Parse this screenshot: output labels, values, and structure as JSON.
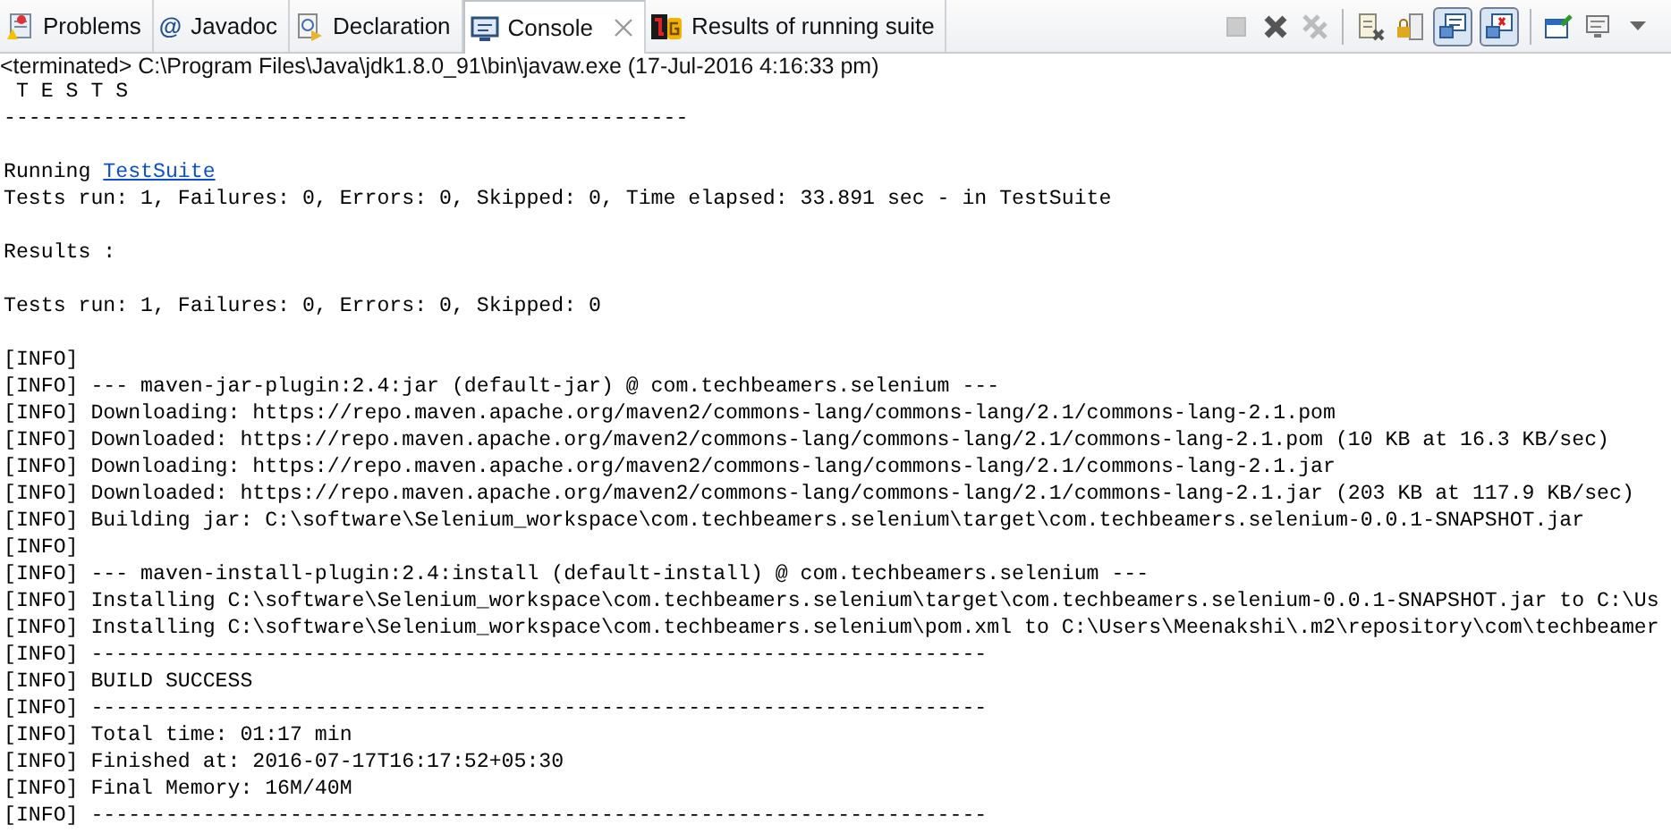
{
  "tabs": [
    {
      "label": "Problems",
      "kind": "problems",
      "selected": false,
      "closable": false
    },
    {
      "label": "Javadoc",
      "kind": "javadoc",
      "glyph": "@",
      "selected": false,
      "closable": false
    },
    {
      "label": "Declaration",
      "kind": "declaration",
      "selected": false,
      "closable": false
    },
    {
      "label": "Console",
      "kind": "console",
      "selected": true,
      "closable": true
    },
    {
      "label": "Results of running suite",
      "kind": "results",
      "selected": false,
      "closable": false
    }
  ],
  "toolbar": [
    {
      "kind": "stop",
      "disabled": true
    },
    {
      "kind": "remove",
      "disabled": false
    },
    {
      "kind": "remove-all",
      "disabled": true
    },
    {
      "kind": "sep"
    },
    {
      "kind": "clear",
      "disabled": false
    },
    {
      "kind": "scroll-lock",
      "disabled": false
    },
    {
      "kind": "show-out",
      "disabled": false,
      "on": true
    },
    {
      "kind": "show-err",
      "disabled": false,
      "on": true
    },
    {
      "kind": "sep"
    },
    {
      "kind": "pin",
      "disabled": false
    },
    {
      "kind": "display",
      "disabled": false
    },
    {
      "kind": "dropdown",
      "disabled": false
    }
  ],
  "status": "<terminated> C:\\Program Files\\Java\\jdk1.8.0_91\\bin\\javaw.exe (17-Jul-2016 4:16:33 pm)",
  "lines": [
    {
      "text": " T E S T S"
    },
    {
      "text": "-------------------------------------------------------",
      "blank_after": true
    },
    {
      "text": "Running ",
      "link": "TestSuite"
    },
    {
      "text": "Tests run: 1, Failures: 0, Errors: 0, Skipped: 0, Time elapsed: 33.891 sec - in TestSuite",
      "blank_after": true
    },
    {
      "text": "Results :",
      "blank_after": true
    },
    {
      "text": "Tests run: 1, Failures: 0, Errors: 0, Skipped: 0",
      "blank_after": true
    },
    {
      "text": "[INFO]"
    },
    {
      "text": "[INFO] --- maven-jar-plugin:2.4:jar (default-jar) @ com.techbeamers.selenium ---"
    },
    {
      "text": "[INFO] Downloading: https://repo.maven.apache.org/maven2/commons-lang/commons-lang/2.1/commons-lang-2.1.pom"
    },
    {
      "text": "[INFO] Downloaded: https://repo.maven.apache.org/maven2/commons-lang/commons-lang/2.1/commons-lang-2.1.pom (10 KB at 16.3 KB/sec)"
    },
    {
      "text": "[INFO] Downloading: https://repo.maven.apache.org/maven2/commons-lang/commons-lang/2.1/commons-lang-2.1.jar"
    },
    {
      "text": "[INFO] Downloaded: https://repo.maven.apache.org/maven2/commons-lang/commons-lang/2.1/commons-lang-2.1.jar (203 KB at 117.9 KB/sec)"
    },
    {
      "text": "[INFO] Building jar: C:\\software\\Selenium_workspace\\com.techbeamers.selenium\\target\\com.techbeamers.selenium-0.0.1-SNAPSHOT.jar"
    },
    {
      "text": "[INFO]"
    },
    {
      "text": "[INFO] --- maven-install-plugin:2.4:install (default-install) @ com.techbeamers.selenium ---"
    },
    {
      "text": "[INFO] Installing C:\\software\\Selenium_workspace\\com.techbeamers.selenium\\target\\com.techbeamers.selenium-0.0.1-SNAPSHOT.jar to C:\\Us"
    },
    {
      "text": "[INFO] Installing C:\\software\\Selenium_workspace\\com.techbeamers.selenium\\pom.xml to C:\\Users\\Meenakshi\\.m2\\repository\\com\\techbeamer"
    },
    {
      "text": "[INFO] ------------------------------------------------------------------------"
    },
    {
      "text": "[INFO] BUILD SUCCESS"
    },
    {
      "text": "[INFO] ------------------------------------------------------------------------"
    },
    {
      "text": "[INFO] Total time: 01:17 min"
    },
    {
      "text": "[INFO] Finished at: 2016-07-17T16:17:52+05:30"
    },
    {
      "text": "[INFO] Final Memory: 16M/40M"
    },
    {
      "text": "[INFO] ------------------------------------------------------------------------"
    }
  ]
}
